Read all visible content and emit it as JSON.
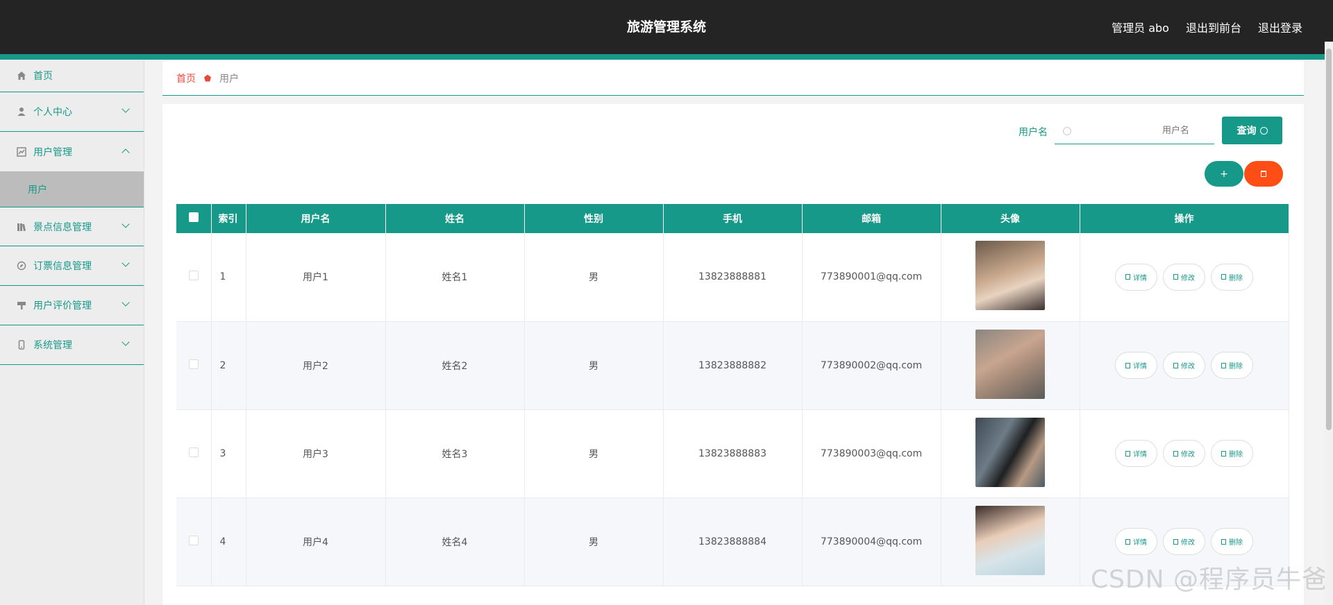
{
  "header": {
    "title": "旅游管理系统",
    "admin": "管理员 abo",
    "frontend": "退出到前台",
    "logout": "退出登录"
  },
  "sidebar": {
    "items": [
      {
        "label": "首页",
        "icon": "home-icon"
      },
      {
        "label": "个人中心",
        "icon": "person-icon"
      },
      {
        "label": "用户管理",
        "icon": "chart-icon"
      },
      {
        "label": "景点信息管理",
        "icon": "library-icon"
      },
      {
        "label": "订票信息管理",
        "icon": "compass-icon"
      },
      {
        "label": "用户评价管理",
        "icon": "hammer-icon"
      },
      {
        "label": "系统管理",
        "icon": "mobile-icon"
      }
    ],
    "sub_item": "用户"
  },
  "breadcrumb": {
    "home": "首页",
    "current": "用户"
  },
  "search": {
    "label": "用户名",
    "placeholder": "用户名",
    "button": "查询"
  },
  "actions": {
    "add": "+"
  },
  "table": {
    "headers": [
      "索引",
      "用户名",
      "姓名",
      "性别",
      "手机",
      "邮箱",
      "头像",
      "操作"
    ],
    "rows": [
      {
        "index": "1",
        "username": "用户1",
        "name": "姓名1",
        "gender": "男",
        "phone": "13823888881",
        "email": "773890001@qq.com"
      },
      {
        "index": "2",
        "username": "用户2",
        "name": "姓名2",
        "gender": "男",
        "phone": "13823888882",
        "email": "773890002@qq.com"
      },
      {
        "index": "3",
        "username": "用户3",
        "name": "姓名3",
        "gender": "男",
        "phone": "13823888883",
        "email": "773890003@qq.com"
      },
      {
        "index": "4",
        "username": "用户4",
        "name": "姓名4",
        "gender": "男",
        "phone": "13823888884",
        "email": "773890004@qq.com"
      }
    ],
    "op_detail": "详情",
    "op_edit": "修改",
    "op_delete": "删除"
  },
  "watermark": "CSDN @程序员牛爸",
  "colors": {
    "primary": "#17998a",
    "danger": "#ff4d16",
    "header_bg": "#242424"
  }
}
